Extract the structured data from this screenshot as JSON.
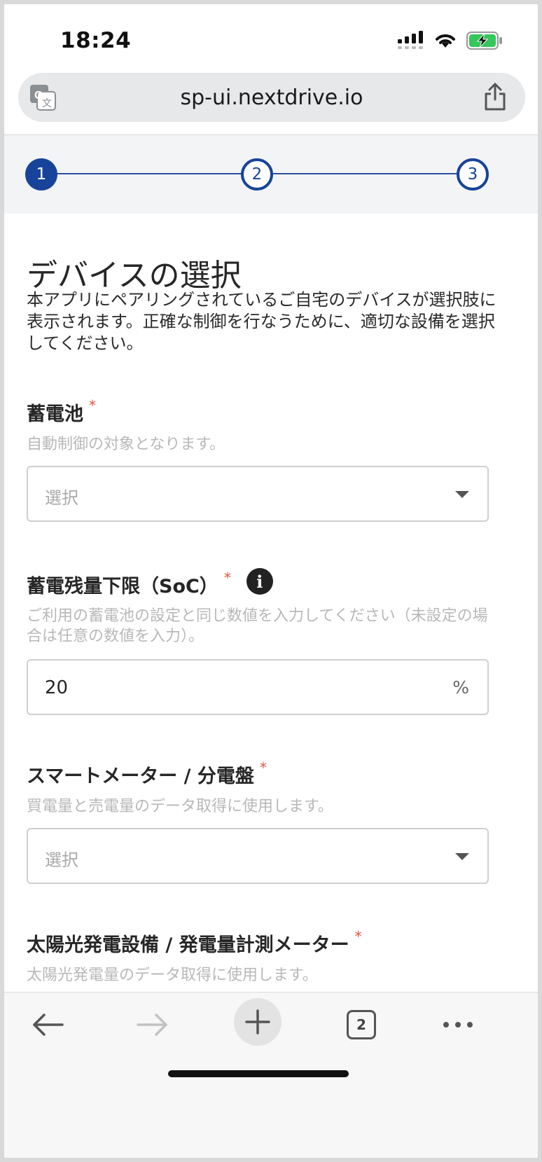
{
  "status_bar": {
    "time": "18:24"
  },
  "browser": {
    "url": "sp-ui.nextdrive.io",
    "tab_count": "2"
  },
  "stepper": {
    "steps": [
      "1",
      "2",
      "3"
    ],
    "current_step": 1
  },
  "page": {
    "title": "デバイスの選択",
    "description": "本アプリにペアリングされているご自宅のデバイスが選択肢に表示されます。正確な制御を行なうために、適切な設備を選択してください。"
  },
  "fields": {
    "battery": {
      "label": "蓄電池",
      "required_mark": "*",
      "help": "自動制御の対象となります。",
      "placeholder": "選択"
    },
    "soc": {
      "label": "蓄電残量下限（SoC）",
      "required_mark": "*",
      "help": "ご利用の蓄電池の設定と同じ数値を入力してください（未設定の場合は任意の数値を入力）。",
      "value": "20",
      "unit": "%"
    },
    "smart_meter": {
      "label": "スマートメーター / 分電盤",
      "required_mark": "*",
      "help": "買電量と売電量のデータ取得に使用します。",
      "placeholder": "選択"
    },
    "solar": {
      "label": "太陽光発電設備 / 発電量計測メーター",
      "required_mark": "*",
      "help": "太陽光発電量のデータ取得に使用します。"
    }
  },
  "colors": {
    "primary": "#17449a",
    "required": "#e5533d",
    "help_text": "#b8b8b8",
    "battery_green": "#34c759"
  },
  "icons": [
    "signal-icon",
    "wifi-icon",
    "battery-charging-icon",
    "translate-icon",
    "share-icon",
    "info-icon",
    "back-arrow-icon",
    "forward-arrow-icon",
    "plus-icon",
    "tabs-icon",
    "more-icon"
  ]
}
